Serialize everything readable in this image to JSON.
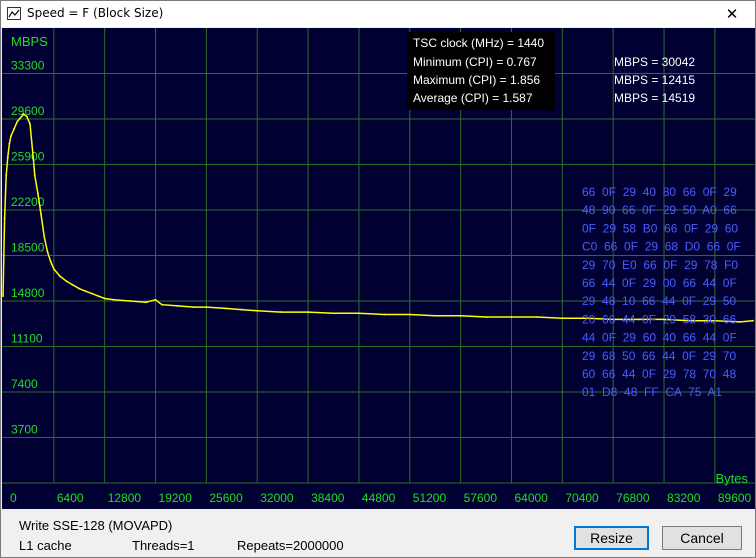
{
  "window": {
    "title": "Speed = F (Block Size)",
    "close_glyph": "✕"
  },
  "chart_data": {
    "type": "line",
    "ylabel": "MBPS",
    "xlabel": "Bytes",
    "y_ticks": [
      0,
      3700,
      7400,
      11100,
      14800,
      18500,
      22200,
      25900,
      29600,
      33300
    ],
    "y_tick_labels": [
      "3700",
      "7400",
      "11100",
      "14800",
      "18500",
      "22200",
      "25900",
      "29600",
      "33300"
    ],
    "x_ticks": [
      0,
      6400,
      12800,
      19200,
      25600,
      32000,
      38400,
      44800,
      51200,
      57600,
      64000,
      70400,
      76800,
      83200,
      89600
    ],
    "x_tick_labels": [
      "0",
      "6400",
      "12800",
      "19200",
      "25600",
      "32000",
      "38400",
      "44800",
      "51200",
      "57600",
      "64000",
      "70400",
      "76800",
      "83200",
      "89600"
    ],
    "xlim": [
      0,
      94400
    ],
    "ylim": [
      0,
      37000
    ],
    "grid": true,
    "series": [
      {
        "x": [
          0,
          200,
          400,
          600,
          800,
          1000,
          1400,
          1800,
          2200,
          2600,
          3000,
          3400,
          3800,
          4000,
          4400,
          4800,
          5200,
          5600,
          6000,
          6400,
          7200,
          8000,
          8800,
          9600,
          10400,
          11200,
          12000,
          12800,
          14000,
          16000,
          18000,
          19200,
          20000,
          22000,
          24000,
          25600,
          28000,
          30000,
          32000,
          35000,
          38400,
          41600,
          44800,
          48000,
          51200,
          54400,
          57600,
          60800,
          64000,
          67200,
          70400,
          73600,
          76800,
          80000,
          83200,
          86400,
          89600,
          92800,
          94400
        ],
        "y": [
          15200,
          21500,
          25000,
          26500,
          27600,
          28200,
          28800,
          29400,
          29700,
          30000,
          29800,
          29200,
          26500,
          25000,
          23500,
          21800,
          20000,
          18800,
          18000,
          17400,
          16800,
          16400,
          16100,
          15800,
          15600,
          15400,
          15200,
          15000,
          14900,
          14800,
          14700,
          14900,
          14500,
          14400,
          14300,
          14300,
          14200,
          14100,
          14000,
          13900,
          13900,
          13800,
          13800,
          13700,
          13700,
          13600,
          13600,
          13500,
          13500,
          13500,
          13400,
          13400,
          13300,
          13300,
          13300,
          13200,
          13200,
          13100,
          13200
        ]
      }
    ]
  },
  "stats": {
    "tsc": "TSC clock (MHz)  = 1440",
    "min": "Minimum (CPI) = 0.767",
    "max": "Maximum (CPI) = 1.856",
    "avg": "Average (CPI) = 1.587",
    "mbps_min": "MBPS = 30042",
    "mbps_max": "MBPS = 12415",
    "mbps_avg": "MBPS = 14519"
  },
  "hex_dump": [
    "66  0F  29  40  80  66  0F  29",
    "48  90  66  0F  29  50  A0  66",
    "0F  29  58  B0  66  0F  29  60",
    "C0  66  0F  29  68  D0  66  0F",
    "29  70  E0  66  0F  29  78  F0",
    "66  44  0F  29  00  66  44  0F",
    "29  48  10  66  44  0F  29  50",
    "20  66  44  0F  29  58  30  66",
    "44  0F  29  60  40  66  44  0F",
    "29  68  50  66  44  0F  29  70",
    "60  66  44  0F  29  78  70  48",
    "01  D8  48  FF  CA  75  A1"
  ],
  "colors": {
    "background": "#000033",
    "grid": "#2f6b28",
    "axis_text": "#22dd22",
    "line": "#ffff00",
    "stats_text": "#ffffff",
    "hex_text": "#4a5cff"
  },
  "status": {
    "test_name": "Write SSE-128 (MOVAPD)",
    "cache": "L1 cache",
    "threads": "Threads=1",
    "repeats": "Repeats=2000000"
  },
  "buttons": {
    "resize": "Resize",
    "cancel": "Cancel"
  }
}
